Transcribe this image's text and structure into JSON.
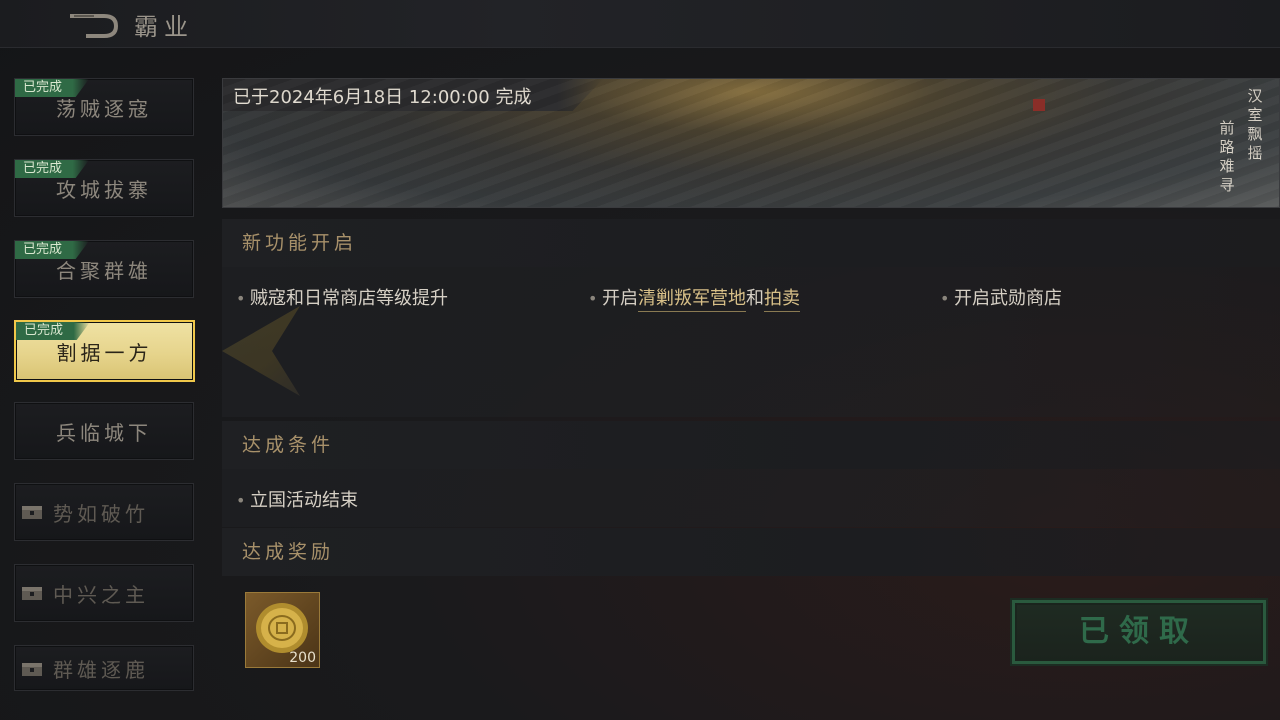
{
  "header": {
    "title": "霸业",
    "back_icon": "back-arrow-icon"
  },
  "sidebar": {
    "items": [
      {
        "label": "荡贼逐寇",
        "status": "已完成"
      },
      {
        "label": "攻城拔寨",
        "status": "已完成"
      },
      {
        "label": "合聚群雄",
        "status": "已完成"
      },
      {
        "label": "割据一方",
        "status": "已完成"
      },
      {
        "label": "兵临城下",
        "status": ""
      },
      {
        "label": "势如破竹",
        "status": ""
      },
      {
        "label": "中兴之主",
        "status": ""
      },
      {
        "label": "群雄逐鹿",
        "status": ""
      }
    ]
  },
  "banner": {
    "date": "已于2024年6月18日 12:00:00 完成",
    "poem_col1": "汉室飘摇",
    "poem_col2": "前路难寻"
  },
  "sections": {
    "features": {
      "title": "新功能开启",
      "item1": "贼寇和日常商店等级提升",
      "item2_prefix": "开启",
      "item2_link1": "清剿叛军营地",
      "item2_mid": "和",
      "item2_link2": "拍卖",
      "item3": "开启武勋商店"
    },
    "conditions": {
      "title": "达成条件",
      "item1": "立国活动结束"
    },
    "rewards": {
      "title": "达成奖励",
      "item_count": "200"
    }
  },
  "claim_button": {
    "label": "已领取"
  },
  "colors": {
    "accent_gold": "#f0c84a",
    "done_green": "#2f6a45",
    "claim_green": "#2f6a4a"
  }
}
